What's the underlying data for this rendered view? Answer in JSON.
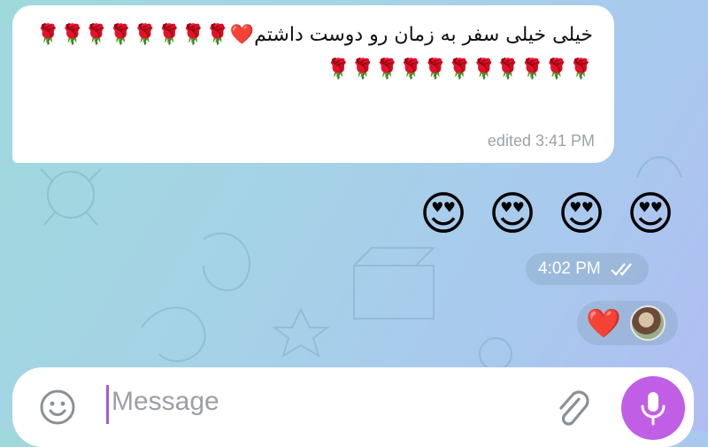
{
  "messages": {
    "incoming_text": "خیلی خیلی سفر به زمان رو دوست داشتم❤️🌹🌹🌹🌹🌹🌹🌹🌹🌹🌹🌹🌹🌹🌹🌹🌹🌹🌹🌹",
    "incoming_meta": "edited 3:41 PM",
    "outgoing_emojis": [
      "😍",
      "😍",
      "😍",
      "😍"
    ],
    "outgoing_time": "4:02 PM",
    "reaction": "❤️"
  },
  "composer": {
    "placeholder": "Message"
  },
  "colors": {
    "accent": "#c05fe6",
    "bubble": "#ffffff"
  },
  "icons": {
    "status": "double-check-icon",
    "emoji": "smile-icon",
    "attach": "paperclip-icon",
    "mic": "microphone-icon"
  }
}
